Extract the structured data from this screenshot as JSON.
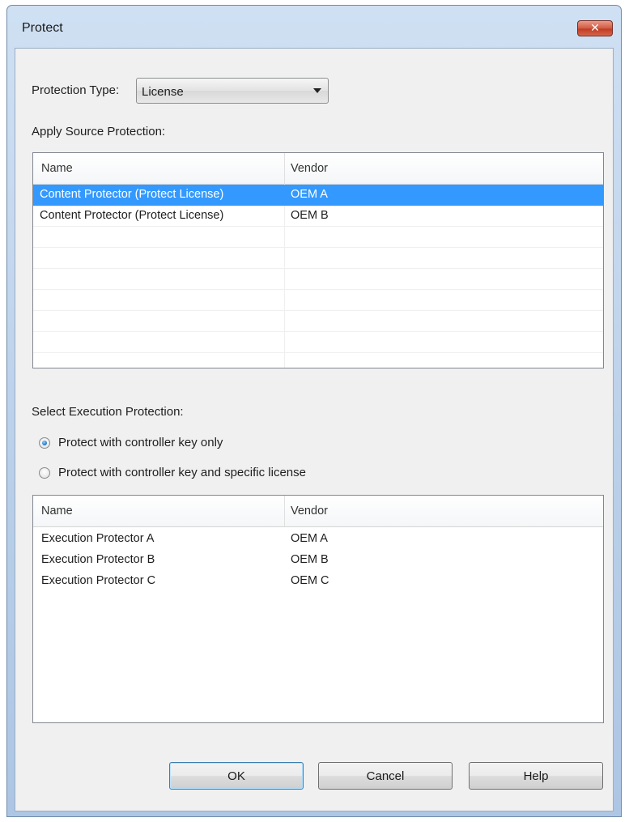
{
  "window": {
    "title": "Protect",
    "close_glyph": "✕"
  },
  "protection_type": {
    "label": "Protection Type:",
    "selected": "License"
  },
  "source_protection": {
    "label": "Apply Source Protection:",
    "columns": [
      "Name",
      "Vendor"
    ],
    "rows": [
      {
        "name": "Content Protector (Protect License)",
        "vendor": "OEM A",
        "selected": true
      },
      {
        "name": "Content Protector (Protect License)",
        "vendor": "OEM B",
        "selected": false
      }
    ]
  },
  "execution_protection": {
    "label": "Select Execution Protection:",
    "options": [
      {
        "label": "Protect with controller key only",
        "checked": true
      },
      {
        "label": "Protect with controller key and specific license",
        "checked": false
      }
    ],
    "columns": [
      "Name",
      "Vendor"
    ],
    "rows": [
      {
        "name": "Execution Protector A",
        "vendor": "OEM A"
      },
      {
        "name": "Execution Protector B",
        "vendor": "OEM B"
      },
      {
        "name": "Execution Protector C",
        "vendor": "OEM C"
      }
    ]
  },
  "buttons": {
    "ok": "OK",
    "cancel": "Cancel",
    "help": "Help"
  },
  "colors": {
    "selection": "#3399ff",
    "close_button": "#c9452a"
  }
}
